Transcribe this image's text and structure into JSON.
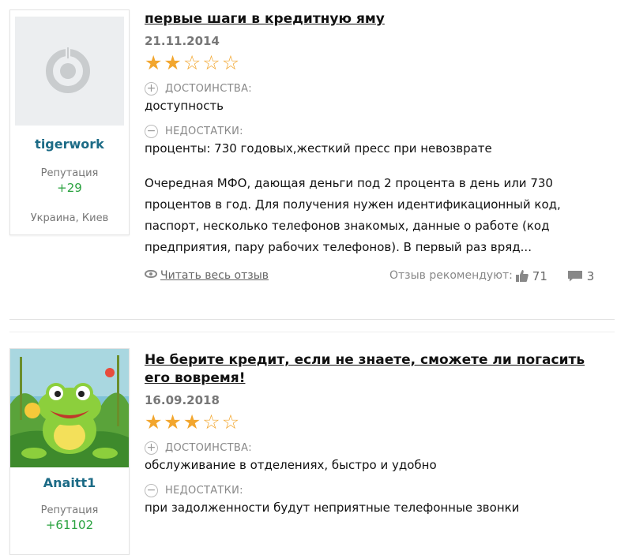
{
  "reviews": [
    {
      "title": "первые шаги в кредитную яму",
      "date": "21.11.2014",
      "rating": 2,
      "max_rating": 5,
      "user": {
        "name": "tigerwork",
        "reputation_label": "Репутация",
        "reputation": "+29",
        "location": "Украина, Киев",
        "avatar": "default-avatar-icon"
      },
      "pros_label": "ДОСТОИНСТВА:",
      "pros": "доступность",
      "cons_label": "НЕДОСТАТКИ:",
      "cons": "проценты: 730 годовых,жесткий пресс при невозврате",
      "text": "Очередная МФО, дающая деньги под 2 процента в день или 730 процентов в год. Для получения нужен идентификационный код, паспорт, несколько телефонов знакомых, данные о работе (код предприятия, пару рабочих телефонов). В первый раз вряд...",
      "read_more": "Читать весь отзыв",
      "recommend_label": "Отзыв рекомендуют:",
      "likes": "71",
      "comments": "3"
    },
    {
      "title": "Не берите кредит, если не знаете, сможете ли погасить его вовремя!",
      "date": "16.09.2018",
      "rating": 3,
      "max_rating": 5,
      "user": {
        "name": "Anaitt1",
        "reputation_label": "Репутация",
        "reputation": "+61102",
        "avatar": "frog-avatar-image"
      },
      "pros_label": "ДОСТОИНСТВА:",
      "pros": "обслуживание в отделениях, быстро и удобно",
      "cons_label": "НЕДОСТАТКИ:",
      "cons": "при задолженности будут неприятные телефонные звонки"
    }
  ],
  "colors": {
    "username": "#1c6b86",
    "reputation": "#2aa23f",
    "star": "#f2a62e"
  }
}
